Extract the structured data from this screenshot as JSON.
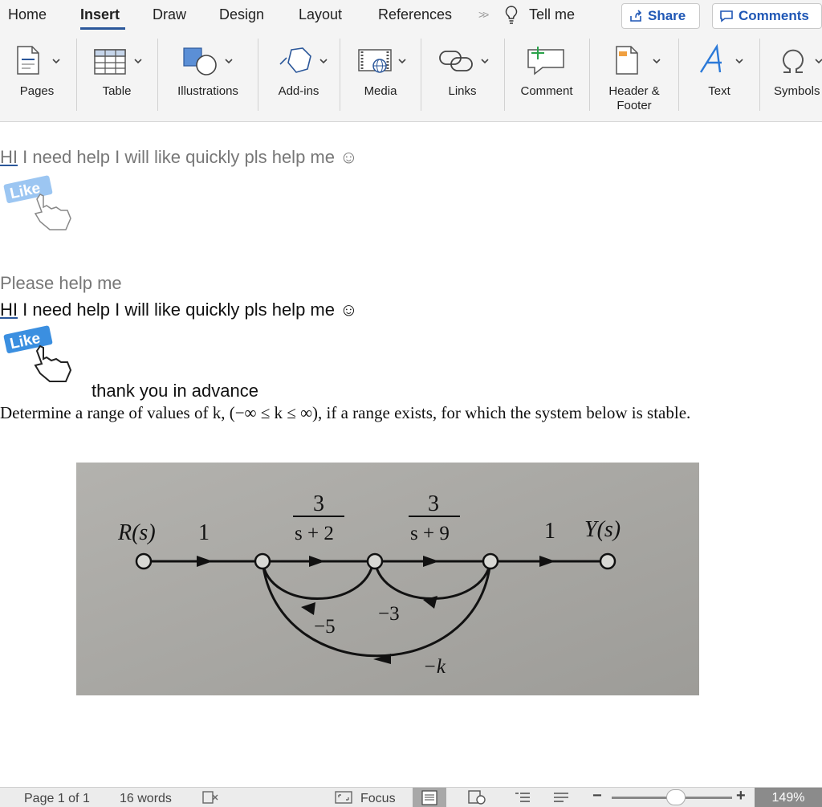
{
  "tabs": [
    "Home",
    "Insert",
    "Draw",
    "Design",
    "Layout",
    "References"
  ],
  "active_tab": "Insert",
  "tell_me": "Tell me",
  "share_label": "Share",
  "comments_label": "Comments",
  "ribbon": {
    "pages": "Pages",
    "table": "Table",
    "illustrations": "Illustrations",
    "addins": "Add-ins",
    "media": "Media",
    "links": "Links",
    "comment": "Comment",
    "header_footer_1": "Header &",
    "header_footer_2": "Footer",
    "text": "Text",
    "symbols": "Symbols"
  },
  "doc": {
    "line1": "I need help I will like quickly pls help me ☺",
    "line1_hi": "HI",
    "like": "Like",
    "please": "Please help me",
    "line2": "I need help I will like quickly pls help me ☺",
    "line2_hi": "HI",
    "thanks": "thank you in advance",
    "problem": "Determine a range of values of k, (−∞ ≤ k ≤ ∞), if a range exists, for which the system below is stable."
  },
  "diagram": {
    "input": "R(s)",
    "output": "Y(s)",
    "gain_in": "1",
    "gain_out": "1",
    "g1_num": "3",
    "g1_den": "s + 2",
    "g2_num": "3",
    "g2_den": "s + 9",
    "fb1": "−5",
    "fb2": "−3",
    "fb3": "−k"
  },
  "status": {
    "page": "Page 1 of 1",
    "words": "16 words",
    "focus": "Focus",
    "zoom": "149%"
  },
  "colors": {
    "accent": "#2b579a",
    "share_text": "#1f57b5",
    "ribbon_bg": "#f4f4f4",
    "like_blue": "#3b8fe0",
    "diagram_bg": "#a9a8a4"
  }
}
